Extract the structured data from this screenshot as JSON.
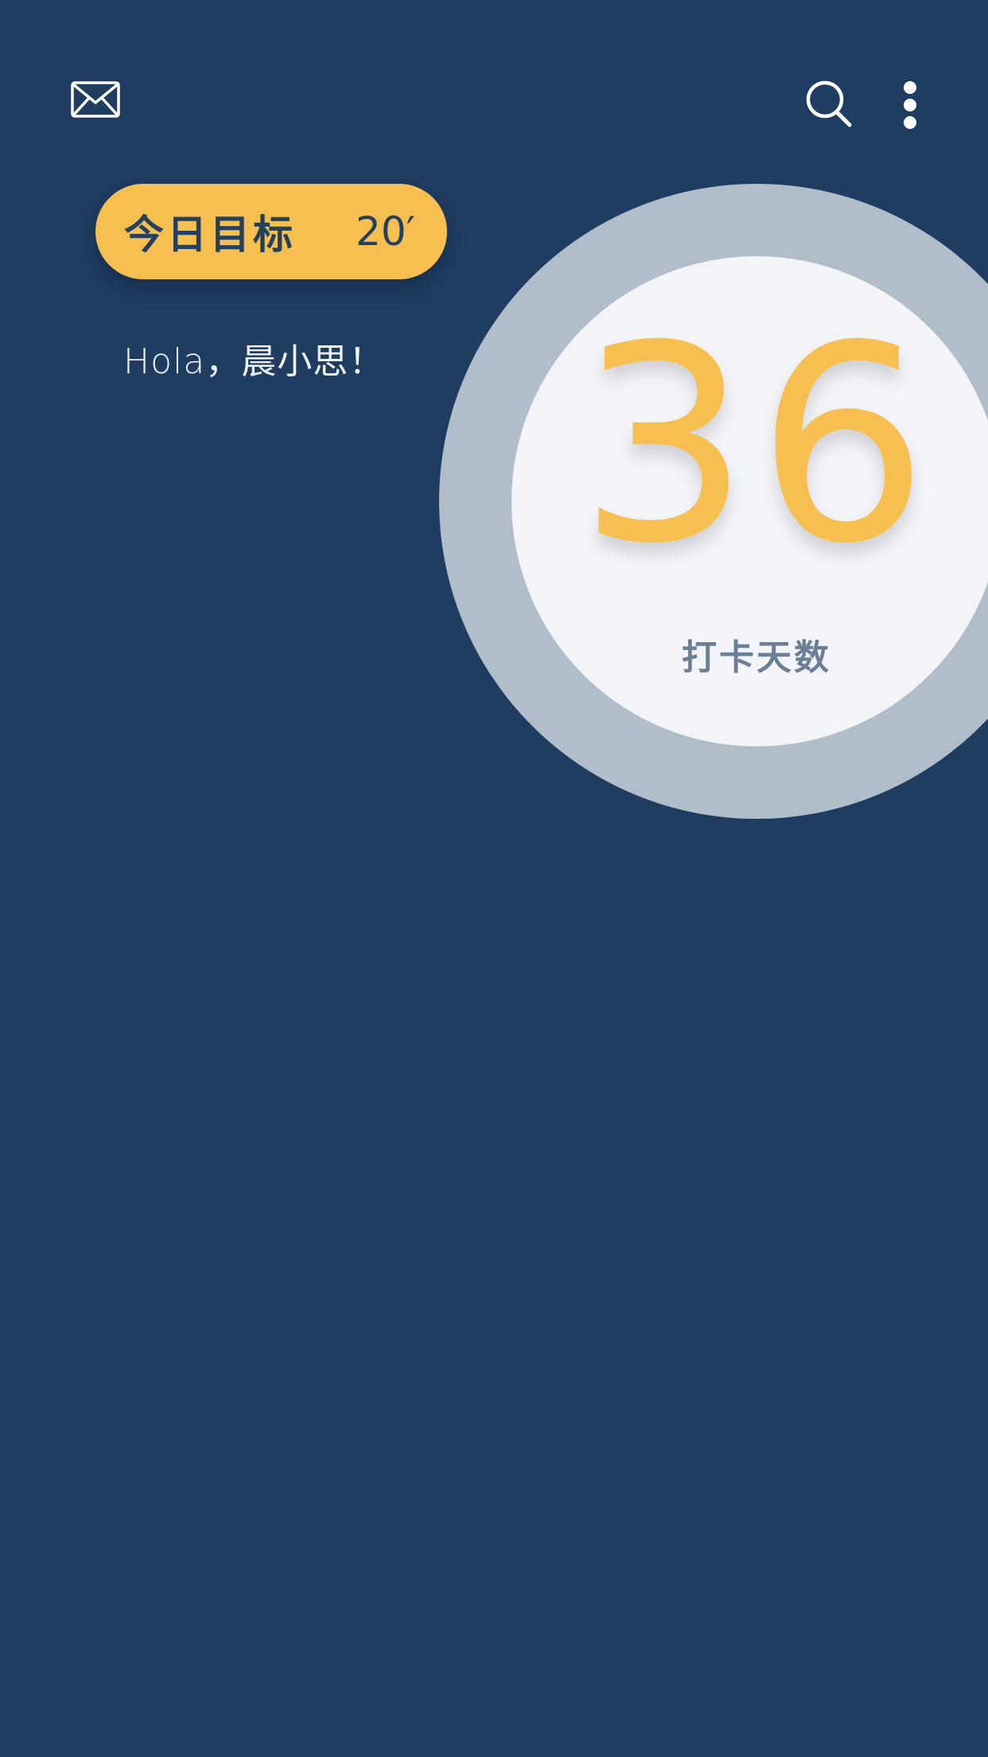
{
  "theme": {
    "background": "#1f3d61",
    "accent": "#f6bf4f",
    "ring": "#b2bdca",
    "ring_inner": "#f2f4f7",
    "caption": "#6a7e96"
  },
  "header": {
    "left_icon": "mail-icon",
    "right_icons": [
      "search-icon",
      "more-vertical-icon"
    ]
  },
  "goal": {
    "label": "今日目标",
    "value": "20′"
  },
  "greeting": "Hola，晨小思！",
  "checkin": {
    "count": "36",
    "caption": "打卡天数"
  }
}
